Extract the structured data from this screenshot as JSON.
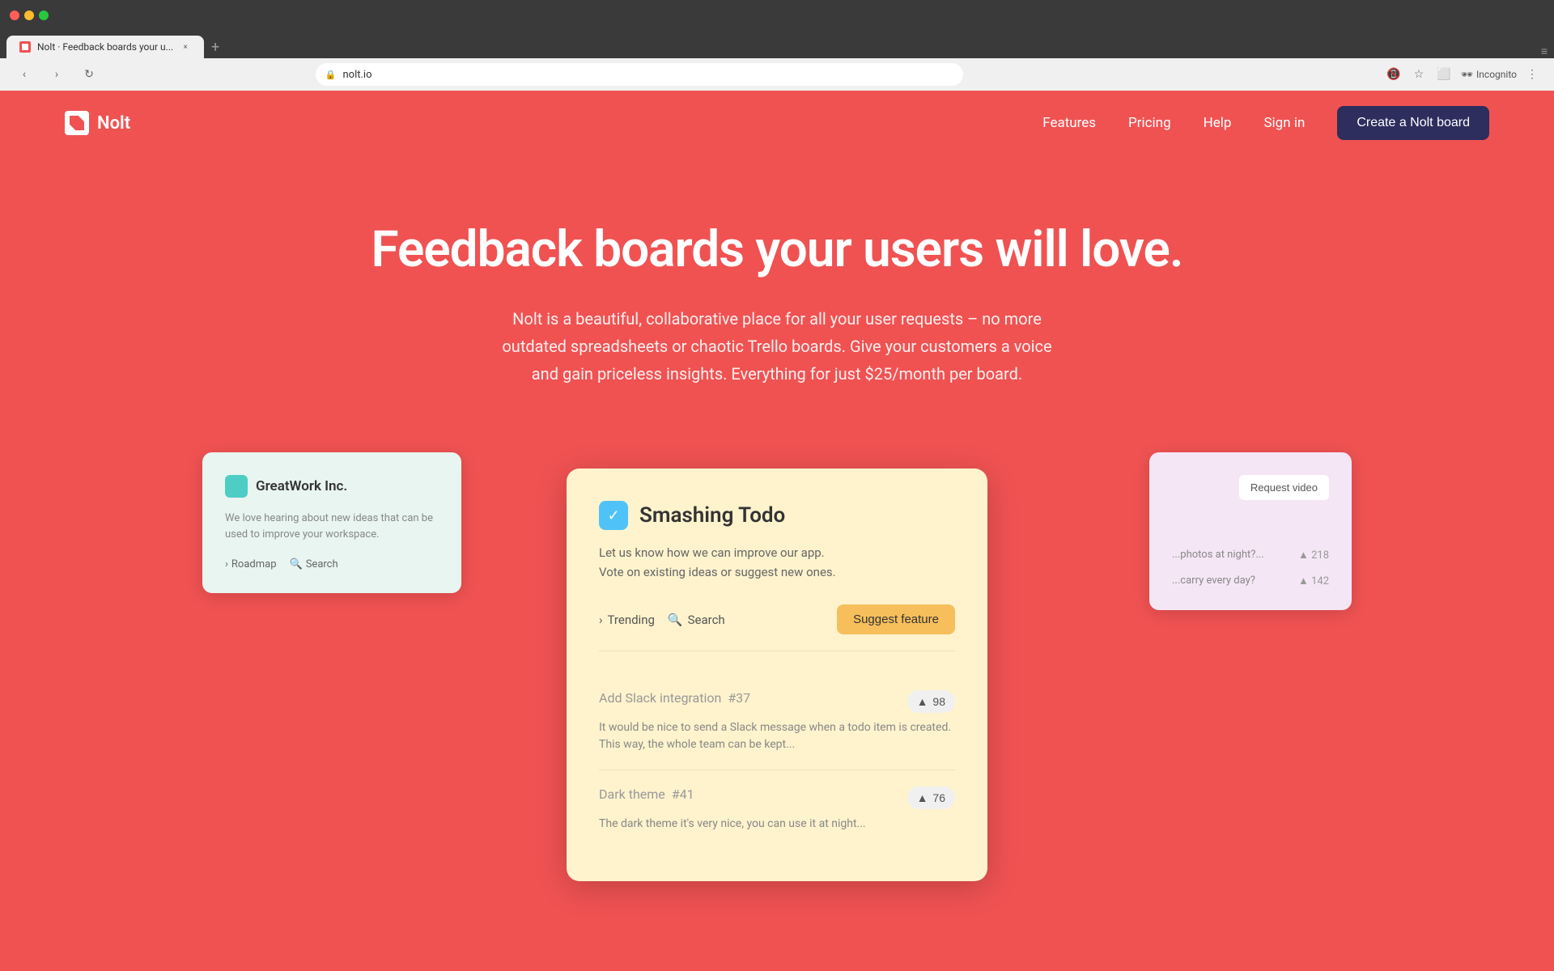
{
  "browser": {
    "tab_title": "Nolt · Feedback boards your u...",
    "url": "nolt.io",
    "tab_close_label": "×",
    "tab_new_label": "+",
    "tab_menu_label": "≡",
    "nav_back": "‹",
    "nav_forward": "›",
    "nav_refresh": "↻",
    "incognito_label": "Incognito"
  },
  "nav": {
    "logo_text": "Nolt",
    "links": [
      {
        "label": "Features",
        "id": "features"
      },
      {
        "label": "Pricing",
        "id": "pricing"
      },
      {
        "label": "Help",
        "id": "help"
      },
      {
        "label": "Sign in",
        "id": "signin"
      }
    ],
    "cta_label": "Create a Nolt board"
  },
  "hero": {
    "title": "Feedback boards your users will love.",
    "subtitle": "Nolt is a beautiful, collaborative place for all your user requests – no more outdated spreadsheets or chaotic Trello boards. Give your customers a voice and gain priceless insights. Everything for just $25/month per board."
  },
  "card_left": {
    "company": "GreatWork Inc.",
    "description": "We love hearing about new ideas that can be used to improve your workspace.",
    "nav_roadmap": "Roadmap",
    "nav_search": "Search"
  },
  "card_center": {
    "title": "Smashing Todo",
    "description_line1": "Let us know how we can improve our app.",
    "description_line2": "Vote on existing ideas or suggest new ones.",
    "action_trending": "Trending",
    "action_search": "Search",
    "action_suggest": "Suggest feature",
    "features": [
      {
        "title": "Add Slack integration",
        "number": "#37",
        "description": "It would be nice to send a Slack message when a todo item is created. This way, the whole team can be kept...",
        "votes": "98"
      },
      {
        "title": "Dark theme",
        "number": "#41",
        "description": "The dark theme it's very nice, you can use it at night...",
        "votes": "76"
      }
    ]
  },
  "card_right": {
    "request_video_label": "Request video",
    "items": [
      {
        "text": "...photos at night?...",
        "votes": "218"
      },
      {
        "text": "...carry every day?",
        "votes": "142"
      }
    ]
  },
  "icons": {
    "lock": "🔒",
    "star": "☆",
    "sidepanel": "⬜",
    "chevron_right": "›",
    "search": "🔍",
    "trending_arrow": "›",
    "vote_up": "▲",
    "check": "✓"
  }
}
